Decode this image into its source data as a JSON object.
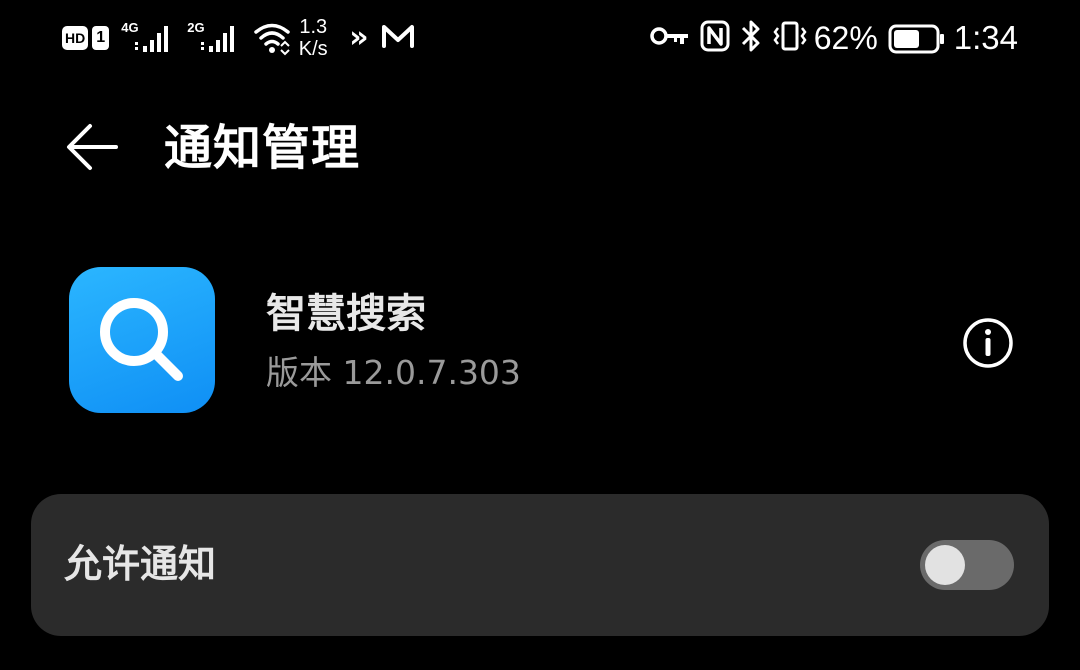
{
  "status_bar": {
    "hd_label": "HD",
    "sim_label": "1",
    "signal1_type": "4G",
    "signal2_type": "2G",
    "speed_value": "1.3",
    "speed_unit": "K/s",
    "more_label": "»",
    "battery_percent": "62%",
    "battery_level": 0.62,
    "time": "1:34",
    "icons": [
      "hd-icon",
      "sim-1-icon",
      "signal-4g-icon",
      "signal-2g-icon",
      "wifi-icon",
      "more-notifications-icon",
      "mail-m-icon",
      "key-icon",
      "nfc-icon",
      "bluetooth-icon",
      "vibrate-icon",
      "battery-icon"
    ]
  },
  "header": {
    "title": "通知管理",
    "back_icon": "back-arrow-icon"
  },
  "app": {
    "name": "智慧搜索",
    "version": "版本 12.0.7.303",
    "icon": "search-icon",
    "icon_color": "#1a9cf9",
    "info_icon": "info-icon"
  },
  "settings": {
    "allow_notifications": {
      "label": "允许通知",
      "enabled": false
    }
  },
  "colors": {
    "background": "#000000",
    "card": "#2b2b2b",
    "toggle_off_track": "#6a6a6a",
    "secondary_text": "#9a9a9a"
  }
}
